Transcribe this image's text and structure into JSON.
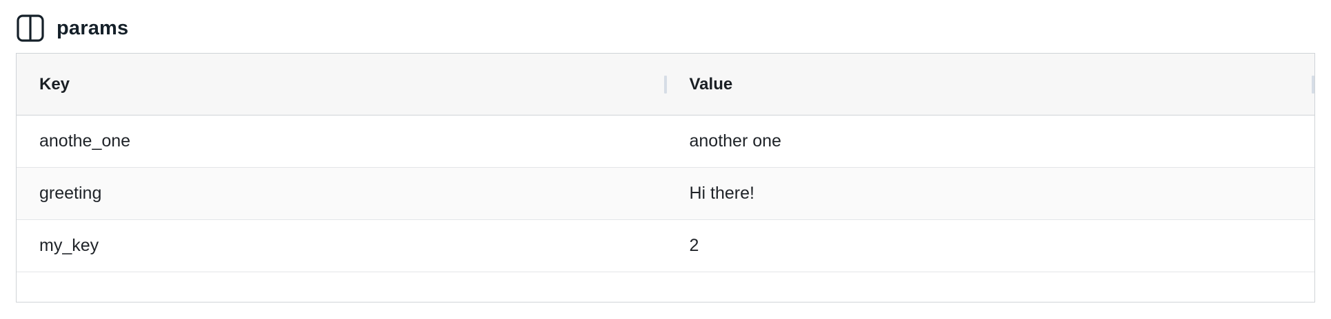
{
  "panel": {
    "title": "params",
    "icon": "split-view-icon"
  },
  "table": {
    "columns": [
      "Key",
      "Value"
    ],
    "rows": [
      {
        "key": "anothe_one",
        "value": "another one"
      },
      {
        "key": "greeting",
        "value": "Hi there!"
      },
      {
        "key": "my_key",
        "value": "2"
      }
    ]
  }
}
